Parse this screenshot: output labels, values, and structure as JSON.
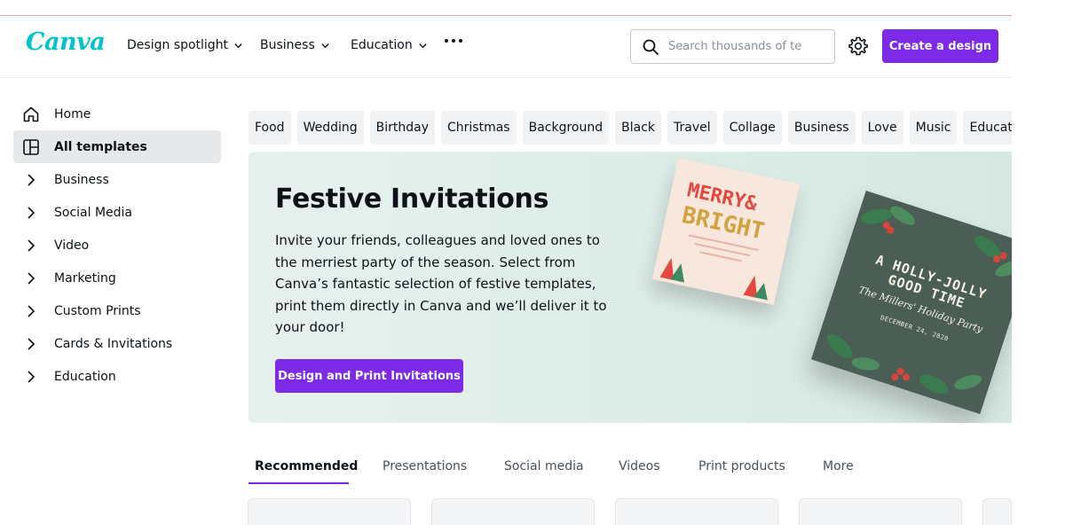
{
  "header": {
    "logo": "Canva",
    "nav": [
      {
        "label": "Design spotlight",
        "dropdown": true
      },
      {
        "label": "Business",
        "dropdown": true
      },
      {
        "label": "Education",
        "dropdown": true
      }
    ],
    "search_placeholder": "Search thousands of te",
    "create_label": "Create a design"
  },
  "sidebar": {
    "items": [
      {
        "label": "Home",
        "icon": "home-icon"
      },
      {
        "label": "All templates",
        "icon": "templates-icon",
        "active": true
      },
      {
        "label": "Business",
        "icon": "chevron-right-icon"
      },
      {
        "label": "Social Media",
        "icon": "chevron-right-icon"
      },
      {
        "label": "Video",
        "icon": "chevron-right-icon"
      },
      {
        "label": "Marketing",
        "icon": "chevron-right-icon"
      },
      {
        "label": "Custom Prints",
        "icon": "chevron-right-icon"
      },
      {
        "label": "Cards & Invitations",
        "icon": "chevron-right-icon"
      },
      {
        "label": "Education",
        "icon": "chevron-right-icon"
      }
    ]
  },
  "chips": [
    "Food",
    "Wedding",
    "Birthday",
    "Christmas",
    "Background",
    "Black",
    "Travel",
    "Collage",
    "Business",
    "Love",
    "Music",
    "Education"
  ],
  "banner": {
    "title": "Festive Invitations",
    "description": "Invite your friends, colleagues and loved ones to the merriest party of the season. Select from Canva’s fantastic selection of festive templates, print them directly in Canva and we’ll deliver it to your door!",
    "button_label": "Design and Print Invitations",
    "card1_line1": "MERRY&",
    "card1_line2": "BRIGHT",
    "card2_line1": "A HOLLY-JOLLY",
    "card2_line2": "GOOD TIME",
    "card2_line3": "The Millers' Holiday Party",
    "card2_line4": "DECEMBER 24, 2020"
  },
  "tabs": [
    {
      "label": "Recommended",
      "active": true
    },
    {
      "label": "Presentations"
    },
    {
      "label": "Social media"
    },
    {
      "label": "Videos"
    },
    {
      "label": "Print products"
    },
    {
      "label": "More"
    }
  ],
  "colors": {
    "brand_purple": "#7d2ae8",
    "brand_teal": "#00c4cc",
    "chip_bg": "#f1f2f4",
    "banner_bg": "#dcece7"
  }
}
